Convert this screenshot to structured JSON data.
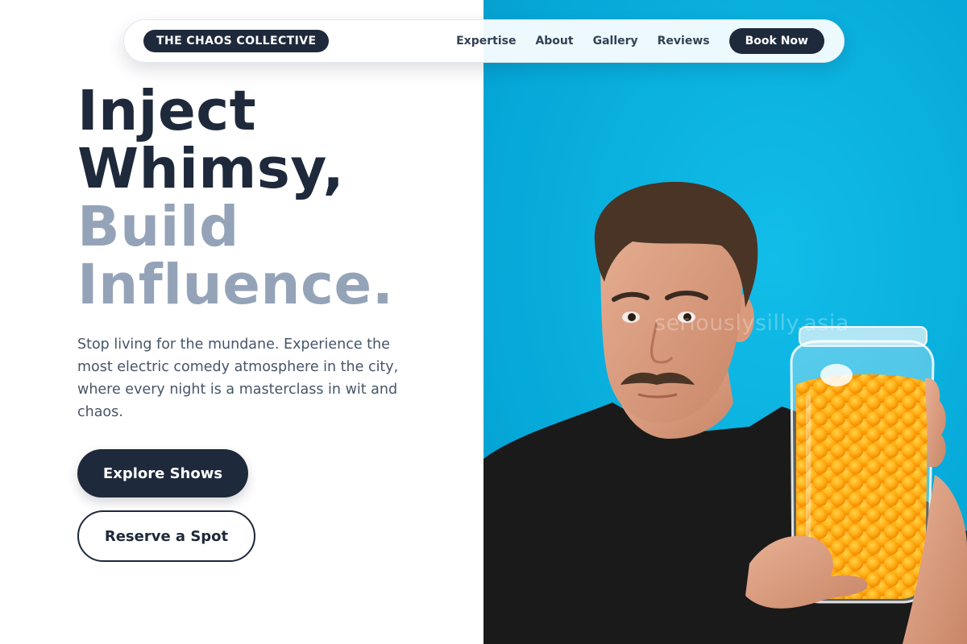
{
  "nav": {
    "brand": "THE CHAOS COLLECTIVE",
    "links": [
      "Expertise",
      "About",
      "Gallery",
      "Reviews"
    ],
    "cta": "Book Now"
  },
  "hero": {
    "headline_dark": [
      "Inject",
      "Whimsy,"
    ],
    "headline_muted": [
      "Build",
      "Influence."
    ],
    "lead": "Stop living for the mundane. Experience the most electric comedy atmosphere in the city, where every night is a masterclass in wit and chaos.",
    "primary_button": "Explore Shows",
    "secondary_button": "Reserve a Spot",
    "image_watermark": "seriouslysilly.asia"
  },
  "colors": {
    "primary": "#1e293b",
    "muted_heading": "#94a3b8",
    "body_text": "#475569",
    "image_background": "#08b4e0"
  }
}
